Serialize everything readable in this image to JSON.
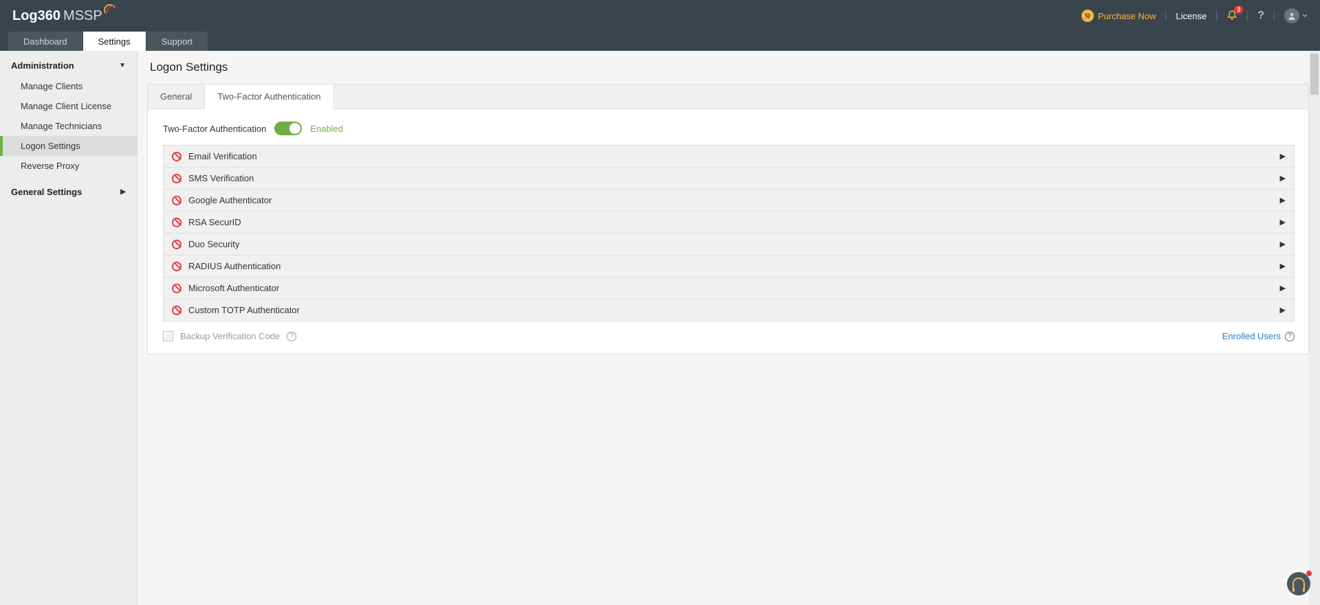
{
  "header": {
    "logo_bold": "Log360",
    "logo_thin": "MSSP",
    "purchase": "Purchase Now",
    "license": "License",
    "notifications_count": "3"
  },
  "main_tabs": [
    "Dashboard",
    "Settings",
    "Support"
  ],
  "main_tabs_active": 1,
  "sidebar": {
    "groups": [
      {
        "label": "Administration",
        "expanded": true,
        "items": [
          "Manage Clients",
          "Manage Client License",
          "Manage Technicians",
          "Logon Settings",
          "Reverse Proxy"
        ],
        "active_index": 3
      },
      {
        "label": "General Settings",
        "expanded": false,
        "items": []
      }
    ]
  },
  "page": {
    "title": "Logon Settings",
    "tabs": [
      "General",
      "Two-Factor Authentication"
    ],
    "tabs_active": 1,
    "tfa_label": "Two-Factor Authentication",
    "tfa_status": "Enabled",
    "methods": [
      "Email Verification",
      "SMS Verification",
      "Google Authenticator",
      "RSA SecurID",
      "Duo Security",
      "RADIUS Authentication",
      "Microsoft Authenticator",
      "Custom TOTP Authenticator"
    ],
    "backup_label": "Backup Verification Code",
    "enrolled_label": "Enrolled Users"
  }
}
